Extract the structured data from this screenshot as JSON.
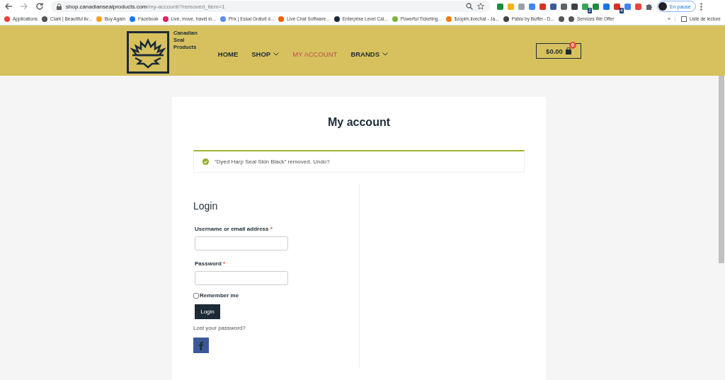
{
  "browser": {
    "url_host": "shop.canadiansealproducts.com",
    "url_path": "/my-account/?removed_item=1",
    "extensions": [
      {
        "color": "#1e8e3e"
      },
      {
        "color": "#f4b400"
      },
      {
        "color": "#9aa0a6"
      },
      {
        "color": "#4285f4"
      },
      {
        "color": "#d93025"
      },
      {
        "color": "#3c5a99"
      },
      {
        "color": "#5f6368"
      },
      {
        "color": "#3c4043"
      },
      {
        "color": "#34a853",
        "badge": "2"
      },
      {
        "color": "#1e8e3e"
      },
      {
        "color": "#1a73e8"
      },
      {
        "color": "#d93025",
        "badge": "4"
      },
      {
        "color": "#4285f4"
      },
      {
        "color": "#e8453c"
      }
    ],
    "profile_label": "En pause",
    "bookmarks": [
      {
        "label": "Applications",
        "color": "#ea4335"
      },
      {
        "label": "Clark | Beautiful liv...",
        "color": "#555555"
      },
      {
        "label": "Buy Again",
        "color": "#f0a020"
      },
      {
        "label": "Facebook",
        "color": "#1877f2"
      },
      {
        "label": "Live, move, travel in...",
        "color": "#e0245e"
      },
      {
        "label": "Prix | Essai Gratuit d...",
        "color": "#5b8def"
      },
      {
        "label": "Live Chat Software...",
        "color": "#ff5a00"
      },
      {
        "label": "Enterprise Level Cal...",
        "color": "#1d2b3a"
      },
      {
        "label": "Powerful Ticketing...",
        "color": "#7cb342"
      },
      {
        "label": "$zopim.livechat - Ja...",
        "color": "#f57c00"
      },
      {
        "label": "Pablo by Buffer - D...",
        "color": "#444444"
      },
      {
        "color": "#555555"
      },
      {
        "label": "Services We Offer",
        "color": "#555555"
      }
    ],
    "more": "»",
    "reading_list": "Liste de lecture"
  },
  "header": {
    "brand": [
      "Canadian",
      "Seal",
      "Products"
    ],
    "nav": [
      {
        "label": "HOME",
        "selected": false,
        "dropdown": false
      },
      {
        "label": "SHOP",
        "selected": false,
        "dropdown": true
      },
      {
        "label": "MY ACCOUNT",
        "selected": true,
        "dropdown": false
      },
      {
        "label": "BRANDS",
        "selected": false,
        "dropdown": true
      }
    ],
    "cart_total": "$0.00",
    "cart_count": "0"
  },
  "page": {
    "title": "My account",
    "notice": "“Dyed Harp Seal Skin Black” removed. Undo?",
    "login": {
      "heading": "Login",
      "fields": [
        {
          "label": "Username or email address",
          "required_mark": "*"
        },
        {
          "label": "Password",
          "required_mark": "*"
        }
      ],
      "remember": {
        "label": "Remember me",
        "checked": false
      },
      "button": "Login",
      "lost_password": "Lost your password?"
    }
  }
}
